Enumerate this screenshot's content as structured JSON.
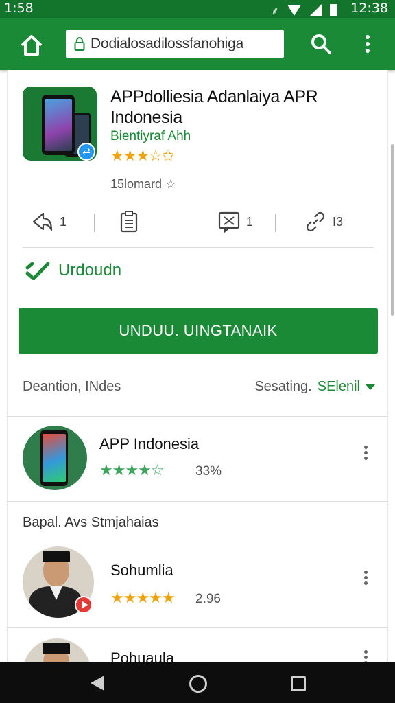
{
  "status_bar": {
    "time_left": "1:58",
    "time_right": "12:38"
  },
  "browser": {
    "url": "Dodialosadilossfanohiga"
  },
  "app": {
    "title": "APPdolliesia Adanlaiya APR Indonesia",
    "developer": "Bientiyraf Ahh",
    "rating_stars": "★★★☆✩",
    "downloads": "15lomard ☆",
    "actions": [
      {
        "icon": "share-icon",
        "count": "1"
      },
      {
        "icon": "clipboard-icon",
        "count": ""
      },
      {
        "icon": "flag-icon",
        "count": "1"
      },
      {
        "icon": "link-icon",
        "count": "I3"
      }
    ]
  },
  "update": {
    "label": "Urdoudn"
  },
  "install_button": {
    "label": "UNDUU. UINGTANAIK"
  },
  "filter": {
    "left_label": "Deantion, INdes",
    "sort_label": "Sesating.",
    "sort_value": "SElenil"
  },
  "related": {
    "title": "APP Indonesia",
    "stars": "★★★★☆",
    "meta": "33%"
  },
  "section": {
    "title": "Bapal. Avs Stmjahaias"
  },
  "people": [
    {
      "name": "Sohumlia",
      "stars": "★★★★★",
      "meta": "2.96"
    },
    {
      "name": "Pohuaula",
      "stars": "",
      "meta": ""
    }
  ],
  "colors": {
    "primary": "#1a8a36",
    "status_bar": "#13742b",
    "star": "#f0a30a",
    "star_green": "#3aa45a"
  }
}
